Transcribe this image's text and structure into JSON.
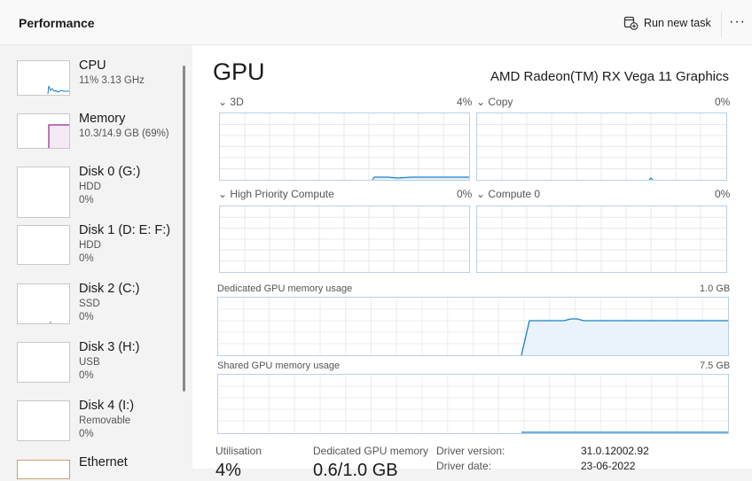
{
  "header": {
    "title": "Performance",
    "run_task_label": "Run new task",
    "more_label": "···"
  },
  "sidebar": {
    "items": [
      {
        "name": "CPU",
        "line1": "11%  3.13 GHz",
        "line2": ""
      },
      {
        "name": "Memory",
        "line1": "10.3/14.9 GB (69%)",
        "line2": ""
      },
      {
        "name": "Disk 0 (G:)",
        "line1": "HDD",
        "line2": "0%"
      },
      {
        "name": "Disk 1 (D: E: F:)",
        "line1": "HDD",
        "line2": "0%"
      },
      {
        "name": "Disk 2 (C:)",
        "line1": "SSD",
        "line2": "0%"
      },
      {
        "name": "Disk 3 (H:)",
        "line1": "USB",
        "line2": "0%"
      },
      {
        "name": "Disk 4 (I:)",
        "line1": "Removable",
        "line2": "0%"
      },
      {
        "name": "Ethernet",
        "line1": "",
        "line2": ""
      }
    ]
  },
  "main": {
    "title": "GPU",
    "gpu_name": "AMD Radeon(TM) RX Vega 11 Graphics",
    "engines": [
      {
        "label": "3D",
        "value": "4%"
      },
      {
        "label": "Copy",
        "value": "0%"
      },
      {
        "label": "High Priority Compute",
        "value": "0%"
      },
      {
        "label": "Compute 0",
        "value": "0%"
      }
    ],
    "dedicated": {
      "label": "Dedicated GPU memory usage",
      "max": "1.0 GB"
    },
    "shared": {
      "label": "Shared GPU memory usage",
      "max": "7.5 GB"
    },
    "stats": {
      "utilisation_label": "Utilisation",
      "utilisation_value": "4%",
      "dedicated_label": "Dedicated GPU memory",
      "dedicated_value": "0.6/1.0 GB",
      "driver_version_label": "Driver version:",
      "driver_version_value": "31.0.12002.92",
      "driver_date_label": "Driver date:",
      "driver_date_value": "23-06-2022"
    }
  },
  "colors": {
    "accent": "#1a7fc4",
    "memory": "#8b2b8c",
    "graph_fill": "#eaf2fb"
  }
}
